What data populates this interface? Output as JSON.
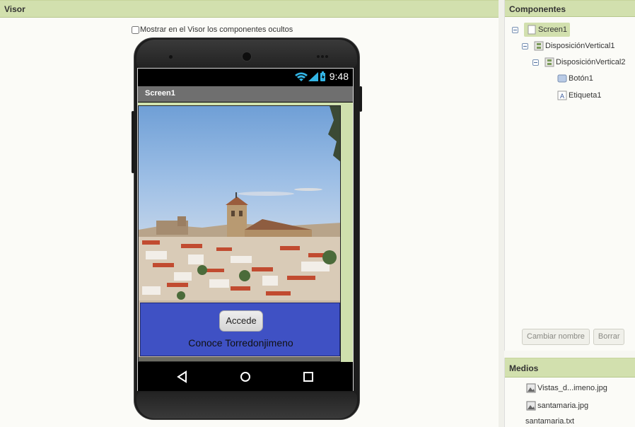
{
  "visor": {
    "title": "Visor",
    "show_hidden_label": "Mostrar en el Visor los componentes ocultos",
    "show_hidden_checked": false
  },
  "phone": {
    "status_time": "9:48",
    "screen_title": "Screen1",
    "button_label": "Accede",
    "label_text": "Conoce Torredonjimeno",
    "box_color": "#3f51c4",
    "title_bar_color": "#6f6f6f"
  },
  "components": {
    "title": "Componentes",
    "tree": [
      {
        "label": "Screen1",
        "icon": "screen-icon",
        "selected": true
      },
      {
        "label": "DisposiciónVertical1",
        "icon": "vertical-arrangement-icon"
      },
      {
        "label": "DisposiciónVertical2",
        "icon": "vertical-arrangement-icon"
      },
      {
        "label": "Botón1",
        "icon": "button-icon"
      },
      {
        "label": "Etiqueta1",
        "icon": "label-icon"
      }
    ],
    "rename_label": "Cambiar nombre",
    "delete_label": "Borrar"
  },
  "media": {
    "title": "Medios",
    "files": [
      {
        "label": "Vistas_d...imeno.jpg",
        "icon": "image-icon"
      },
      {
        "label": "santamaria.jpg",
        "icon": "image-icon"
      },
      {
        "label": "santamaria.txt"
      }
    ]
  },
  "colors": {
    "header": "#d2e0ae",
    "accent": "#cfe0ad"
  }
}
